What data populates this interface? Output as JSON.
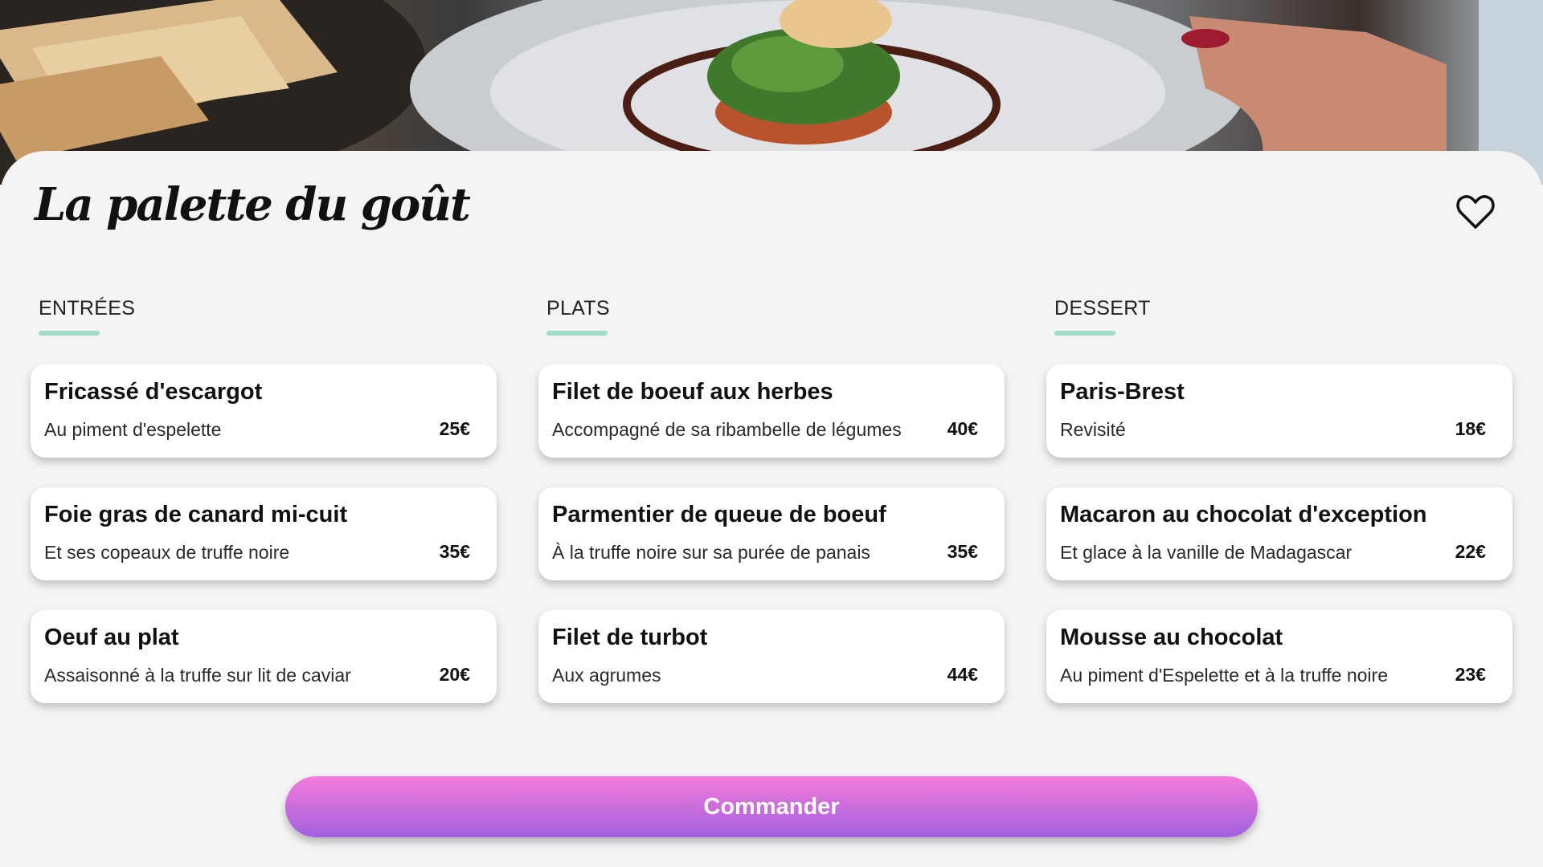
{
  "restaurant": {
    "title": "La palette du goût"
  },
  "icons": {
    "favorite": "heart-outline-icon"
  },
  "menu": {
    "columns": [
      {
        "heading": "ENTRÉES",
        "items": [
          {
            "name": "Fricassé d'escargot",
            "description": "Au piment d'espelette",
            "price": "25€"
          },
          {
            "name": "Foie gras de canard mi-cuit",
            "description": "Et ses copeaux de truffe noire",
            "price": "35€"
          },
          {
            "name": "Oeuf au plat",
            "description": "Assaisonné à la truffe sur lit de caviar",
            "price": "20€"
          }
        ]
      },
      {
        "heading": "PLATS",
        "items": [
          {
            "name": "Filet de boeuf aux herbes",
            "description": "Accompagné de sa ribambelle de légumes",
            "price": "40€"
          },
          {
            "name": "Parmentier de queue de boeuf",
            "description": "À la truffe noire sur sa purée de panais",
            "price": "35€"
          },
          {
            "name": "Filet de turbot",
            "description": "Aux agrumes",
            "price": "44€"
          }
        ]
      },
      {
        "heading": "DESSERT",
        "items": [
          {
            "name": "Paris-Brest",
            "description": "Revisité",
            "price": "18€"
          },
          {
            "name": "Macaron au chocolat d'exception",
            "description": "Et glace à la vanille de Madagascar",
            "price": "22€"
          },
          {
            "name": "Mousse au chocolat",
            "description": "Au piment d'Espelette et à la truffe noire",
            "price": "23€"
          }
        ]
      }
    ]
  },
  "actions": {
    "order_label": "Commander"
  },
  "colors": {
    "accent_underline": "#9fdcc9",
    "button_top": "#f47bdb",
    "button_bottom": "#a160de",
    "background": "#f4f4f4"
  }
}
